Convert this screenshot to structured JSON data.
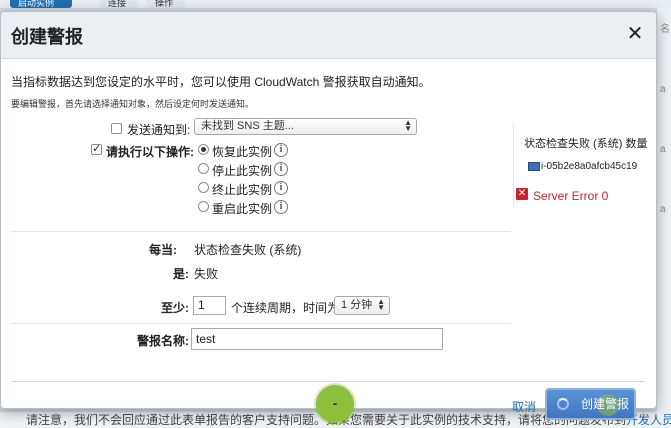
{
  "background": {
    "tabs": [
      "启动实例",
      "连接",
      "操作"
    ],
    "right_chars": [
      "名",
      "a",
      "a",
      "a"
    ],
    "bottom_text": "请注意，我们不会回应通过此表单报告的客户支持问题。如果您需要关于此实例的技术支持，请将您的问题发布到",
    "bottom_link": "开发人员论坛上"
  },
  "modal": {
    "title": "创建警报",
    "close_label": "✕",
    "intro": "当指标数据达到您设定的水平时，您可以使用 CloudWatch 警报获取自动通知。",
    "hint": "要编辑警报，首先请选择通知对象，然后设定何时发送通知。",
    "notify": {
      "label": "发送通知到:",
      "checked": false,
      "select_value": "未找到 SNS 主题..."
    },
    "action": {
      "label": "请执行以下操作:",
      "checked": true,
      "options": [
        {
          "label": "恢复此实例",
          "selected": true
        },
        {
          "label": "停止此实例",
          "selected": false
        },
        {
          "label": "终止此实例",
          "selected": false
        },
        {
          "label": "重启此实例",
          "selected": false
        }
      ],
      "info_glyph": "i"
    },
    "condition": {
      "whenever_label": "每当:",
      "whenever_value": "状态检查失败 (系统)",
      "is_label": "是:",
      "is_value": "失败",
      "atleast_label": "至少:",
      "atleast_value": "1",
      "periods_text": "个连续周期，时间为",
      "period_value": "1 分钟"
    },
    "alarm_name": {
      "label": "警报名称:",
      "value": "test"
    },
    "side": {
      "title": "状态检查失败 (系统) 数量",
      "instance_id": "i-05b2e8a0afcb45c19",
      "instance_color": "#3f6fb6",
      "error_icon": "✕",
      "error_text": "Server Error 0",
      "error_color": "#c8262c"
    },
    "footer": {
      "loader_text": "-",
      "cancel_label": "取消",
      "create_label": "创建警报"
    }
  }
}
